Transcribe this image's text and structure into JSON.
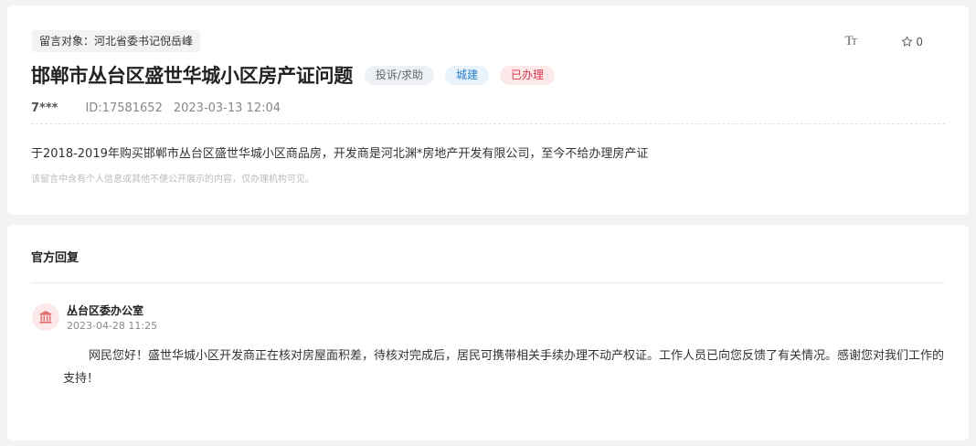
{
  "message": {
    "target": "留言对象：河北省委书记倪岳峰",
    "title": "邯郸市丛台区盛世华城小区房产证问题",
    "tags": {
      "type": "投诉/求助",
      "category": "城建",
      "status": "已办理"
    },
    "tools": {
      "font_size_icon": "font-size-icon",
      "star_icon": "star-icon",
      "star_count": "0"
    },
    "user": "7***",
    "id": "ID:17581652",
    "datetime": "2023-03-13 12:04",
    "content": "于2018-2019年购买邯郸市丛台区盛世华城小区商品房，开发商是河北渊*房地产开发有限公司，至今不给办理房产证",
    "privacy_note": "该留言中含有个人信息或其他不便公开展示的内容，仅办理机构可见。"
  },
  "reply": {
    "header": "官方回复",
    "department": "丛台区委办公室",
    "avatar_icon": "government-building-icon",
    "datetime": "2023-04-28 11:25",
    "text": "网民您好！盛世华城小区开发商正在核对房屋面积差，待核对完成后，居民可携带相关手续办理不动产权证。工作人员已向您反馈了有关情况。感谢您对我们工作的支持！"
  },
  "colors": {
    "page_bg": "#f2f3f5",
    "tag_category": "#2b7fc7",
    "tag_status": "#e0344a",
    "avatar_icon": "#e07070"
  }
}
